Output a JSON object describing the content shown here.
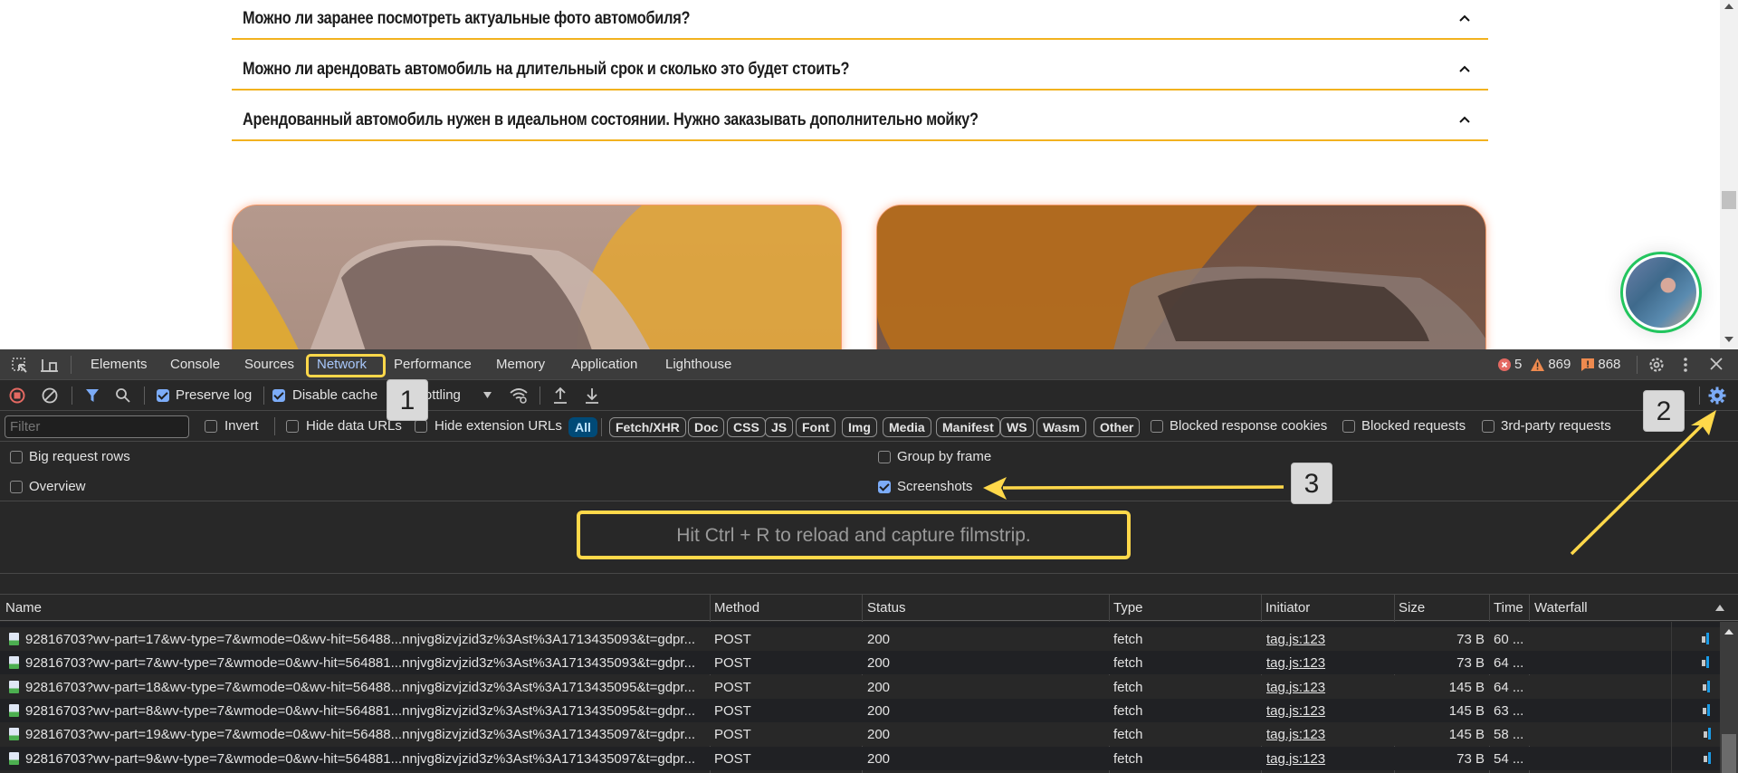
{
  "page": {
    "faq": [
      {
        "question": "Можно ли заранее посмотреть актуальные фото автомобиля?"
      },
      {
        "question": "Можно ли арендовать автомобиль на длительный срок и сколько это будет стоить?"
      },
      {
        "question": "Арендованный автомобиль нужен в идеальном состоянии. Нужно заказывать дополнительно мойку?"
      }
    ],
    "accent_color": "#f2b21f",
    "chat_widget": {
      "icon": "operator-avatar",
      "ring_color": "#22c55e"
    }
  },
  "devtools": {
    "tabs": [
      "Elements",
      "Console",
      "Sources",
      "Network",
      "Performance",
      "Memory",
      "Application",
      "Lighthouse"
    ],
    "active_tab": "Network",
    "status": {
      "errors": "5",
      "warnings": "869",
      "issues": "868"
    },
    "toolbar": {
      "preserve_log": {
        "label": "Preserve log",
        "checked": true
      },
      "disable_cache": {
        "label": "Disable cache",
        "checked": true
      },
      "throttling": "No throttling"
    },
    "filter": {
      "placeholder": "Filter",
      "invert": "Invert",
      "hide_data_urls": "Hide data URLs",
      "hide_extension_urls": "Hide extension URLs",
      "types": [
        "All",
        "Fetch/XHR",
        "Doc",
        "CSS",
        "JS",
        "Font",
        "Img",
        "Media",
        "Manifest",
        "WS",
        "Wasm",
        "Other"
      ],
      "active_type": "All",
      "blocked_response_cookies": "Blocked response cookies",
      "blocked_requests": "Blocked requests",
      "third_party_requests": "3rd-party requests"
    },
    "settings": {
      "big_request_rows": {
        "label": "Big request rows",
        "checked": false
      },
      "overview": {
        "label": "Overview",
        "checked": false
      },
      "group_by_frame": {
        "label": "Group by frame",
        "checked": false
      },
      "screenshots": {
        "label": "Screenshots",
        "checked": true
      }
    },
    "filmstrip_hint": "Hit Ctrl + R to reload and capture filmstrip.",
    "table": {
      "columns": [
        "Name",
        "Method",
        "Status",
        "Type",
        "Initiator",
        "Size",
        "Time",
        "Waterfall"
      ],
      "rows": [
        {
          "name": "92816703?wv-part=17&wv-type=7&wmode=0&wv-hit=56488...nnjvg8izvjzid3z%3Ast%3A1713435093&t=gdpr...",
          "method": "POST",
          "status": "200",
          "type": "fetch",
          "initiator": "tag.js:123",
          "size": "73 B",
          "time": "60 ..."
        },
        {
          "name": "92816703?wv-part=7&wv-type=7&wmode=0&wv-hit=564881...nnjvg8izvjzid3z%3Ast%3A1713435093&t=gdpr...",
          "method": "POST",
          "status": "200",
          "type": "fetch",
          "initiator": "tag.js:123",
          "size": "73 B",
          "time": "64 ..."
        },
        {
          "name": "92816703?wv-part=18&wv-type=7&wmode=0&wv-hit=56488...nnjvg8izvjzid3z%3Ast%3A1713435095&t=gdpr...",
          "method": "POST",
          "status": "200",
          "type": "fetch",
          "initiator": "tag.js:123",
          "size": "145 B",
          "time": "64 ..."
        },
        {
          "name": "92816703?wv-part=8&wv-type=7&wmode=0&wv-hit=564881...nnjvg8izvjzid3z%3Ast%3A1713435095&t=gdpr...",
          "method": "POST",
          "status": "200",
          "type": "fetch",
          "initiator": "tag.js:123",
          "size": "145 B",
          "time": "63 ..."
        },
        {
          "name": "92816703?wv-part=19&wv-type=7&wmode=0&wv-hit=56488...nnjvg8izvjzid3z%3Ast%3A1713435097&t=gdpr...",
          "method": "POST",
          "status": "200",
          "type": "fetch",
          "initiator": "tag.js:123",
          "size": "145 B",
          "time": "58 ..."
        },
        {
          "name": "92816703?wv-part=9&wv-type=7&wmode=0&wv-hit=564881...nnjvg8izvjzid3z%3Ast%3A1713435097&t=gdpr...",
          "method": "POST",
          "status": "200",
          "type": "fetch",
          "initiator": "tag.js:123",
          "size": "73 B",
          "time": "54 ..."
        }
      ]
    }
  },
  "annotations": {
    "step1": "1",
    "step2": "2",
    "step3": "3",
    "highlight_color": "#ffd84a"
  }
}
